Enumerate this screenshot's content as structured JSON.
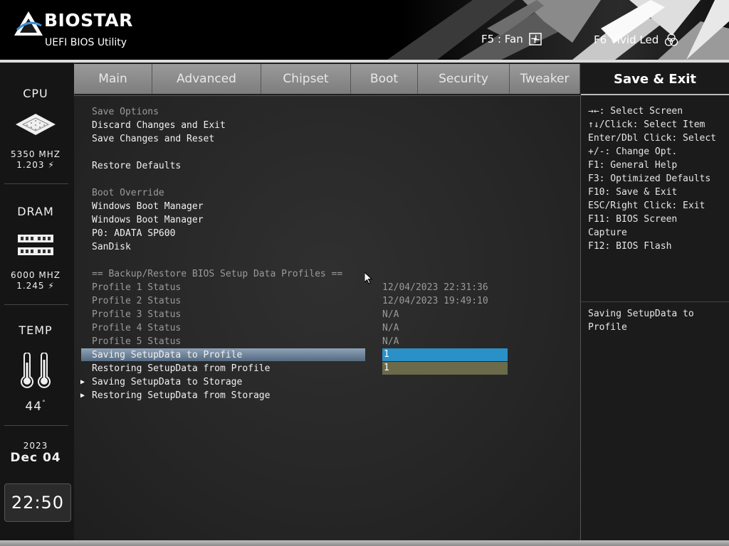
{
  "header": {
    "brand": "BIOSTAR",
    "subtitle": "UEFI BIOS Utility",
    "f5_label": "F5 : Fan",
    "f6_label": "F6 Vivid Led"
  },
  "left_panel": {
    "cpu_title": "CPU",
    "cpu_freq": "5350 MHZ",
    "cpu_volt": "1.203",
    "dram_title": "DRAM",
    "dram_freq": "6000 MHZ",
    "dram_volt": "1.245",
    "temp_title": "TEMP",
    "temp_value": "44",
    "year": "2023",
    "date": "Dec 04",
    "time": "22:50"
  },
  "tabs": [
    "Main",
    "Advanced",
    "Chipset",
    "Boot",
    "Security",
    "Tweaker"
  ],
  "active_tab": "Save & Exit",
  "main": {
    "save_options_header": "Save Options",
    "discard_exit": "Discard Changes and Exit",
    "save_reset": "Save Changes and Reset",
    "restore_defaults": "Restore Defaults",
    "boot_override_header": "Boot Override",
    "boot_items": [
      "Windows Boot Manager",
      "Windows Boot Manager",
      "P0: ADATA SP600",
      "SanDisk"
    ],
    "backup_header": "== Backup/Restore BIOS Setup Data Profiles ==",
    "profiles": [
      {
        "label": "Profile 1 Status",
        "value": "12/04/2023 22:31:36"
      },
      {
        "label": "Profile 2 Status",
        "value": "12/04/2023 19:49:10"
      },
      {
        "label": "Profile 3 Status",
        "value": "N/A"
      },
      {
        "label": "Profile 4 Status",
        "value": "N/A"
      },
      {
        "label": "Profile 5 Status",
        "value": "N/A"
      }
    ],
    "saving_profile_label": "Saving SetupData to Profile",
    "saving_profile_value": "1",
    "restoring_profile_label": "Restoring SetupData from Profile",
    "restoring_profile_value": "1",
    "saving_storage": "Saving SetupData to Storage",
    "restoring_storage": "Restoring SetupData from Storage"
  },
  "help": {
    "keys": [
      "→←: Select Screen",
      "↑↓/Click: Select Item",
      "Enter/Dbl Click: Select",
      "+/-: Change Opt.",
      "F1: General Help",
      "F3: Optimized Defaults",
      "F10: Save & Exit",
      "ESC/Right Click: Exit",
      "F11: BIOS Screen",
      "Capture",
      "F12: BIOS Flash"
    ],
    "description_line1": "Saving SetupData to",
    "description_line2": "Profile"
  },
  "colors": {
    "highlight": "#2a90c8",
    "olive": "#6b6a4a",
    "tab_bg": "#8a8a8a"
  }
}
